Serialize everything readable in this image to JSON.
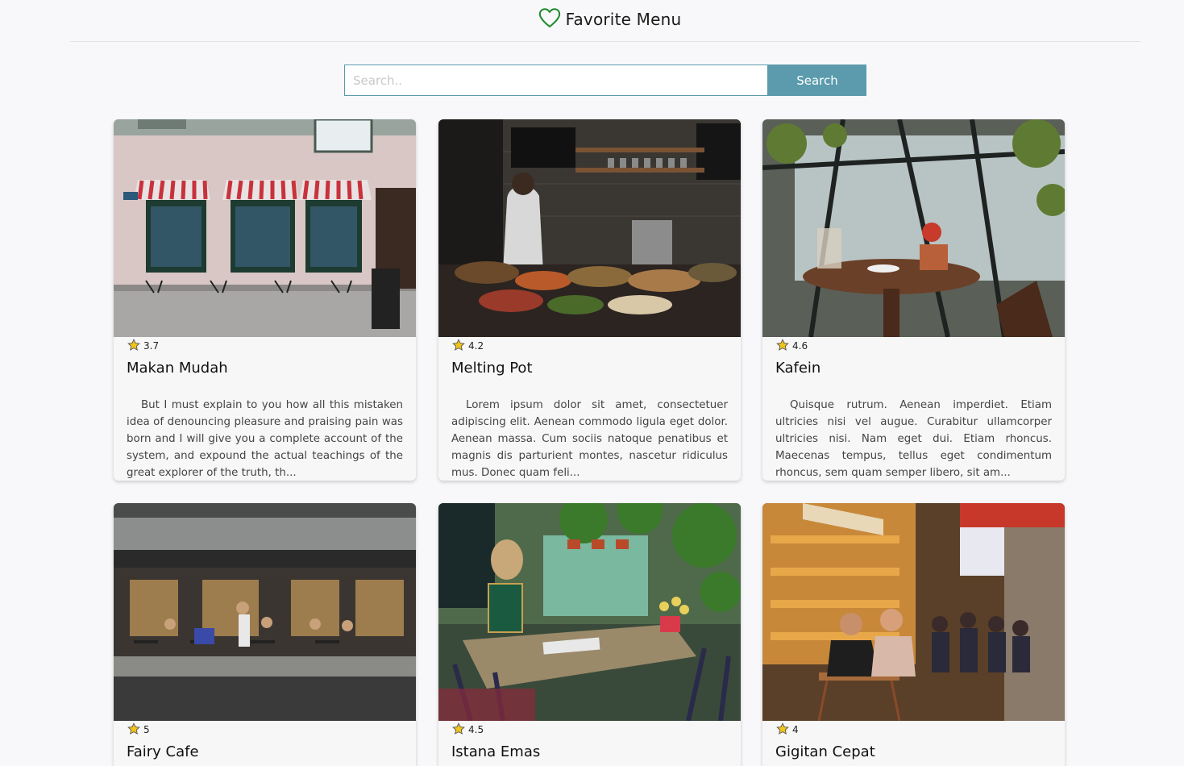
{
  "header": {
    "title": "Favorite Menu",
    "icon": "heart-outline-icon",
    "icon_color": "#1f8a2e"
  },
  "search": {
    "placeholder": "Search..",
    "value": "",
    "button_label": "Search",
    "accent": "#5b9bad"
  },
  "cards": [
    {
      "name": "Makan Mudah",
      "rating": "3.7",
      "image": "cafe-storefront-awnings-photo",
      "description": "But I must explain to you how all this mistaken idea of denouncing pleasure and praising pain was born and I will give you a complete account of the system, and expound the actual teachings of the great explorer of the truth, th..."
    },
    {
      "name": "Melting Pot",
      "rating": "4.2",
      "image": "kitchen-counter-chef-photo",
      "description": "Lorem ipsum dolor sit amet, consectetuer adipiscing elit. Aenean commodo ligula eget dolor. Aenean massa. Cum sociis natoque penatibus et magnis dis parturient montes, nascetur ridiculus mus. Donec quam feli..."
    },
    {
      "name": "Kafein",
      "rating": "4.6",
      "image": "greenhouse-table-coffee-photo",
      "description": "Quisque rutrum. Aenean imperdiet. Etiam ultricies nisi vel augue. Curabitur ullamcorper ultricies nisi. Nam eget dui. Etiam rhoncus. Maecenas tempus, tellus eget condimentum rhoncus, sem quam semper libero, sit am..."
    },
    {
      "name": "Fairy Cafe",
      "rating": "5",
      "image": "street-cafe-people-photo",
      "description": ""
    },
    {
      "name": "Istana Emas",
      "rating": "4.5",
      "image": "garden-cafe-table-photo",
      "description": ""
    },
    {
      "name": "Gigitan Cepat",
      "rating": "4",
      "image": "sidewalk-bakery-couple-photo",
      "description": ""
    }
  ],
  "star_color": "#f0c419"
}
